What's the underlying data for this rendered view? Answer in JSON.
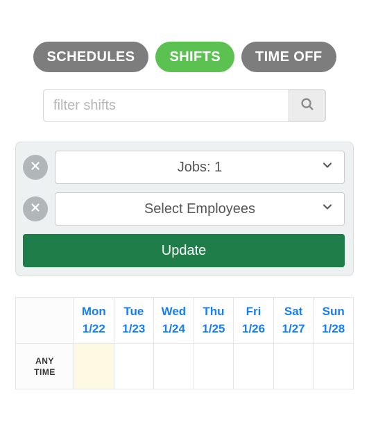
{
  "tabs": {
    "schedules": "SCHEDULES",
    "shifts": "SHIFTS",
    "timeoff": "TIME OFF",
    "active": "shifts"
  },
  "filter": {
    "placeholder": "filter shifts",
    "value": ""
  },
  "panel": {
    "jobs_label": "Jobs: 1",
    "employees_label": "Select Employees",
    "update_label": "Update"
  },
  "schedule": {
    "row_label": "ANY\nTIME",
    "highlight_index": 0,
    "days": [
      {
        "name": "Mon",
        "date": "1/22"
      },
      {
        "name": "Tue",
        "date": "1/23"
      },
      {
        "name": "Wed",
        "date": "1/24"
      },
      {
        "name": "Thu",
        "date": "1/25"
      },
      {
        "name": "Fri",
        "date": "1/26"
      },
      {
        "name": "Sat",
        "date": "1/27"
      },
      {
        "name": "Sun",
        "date": "1/28"
      }
    ]
  }
}
